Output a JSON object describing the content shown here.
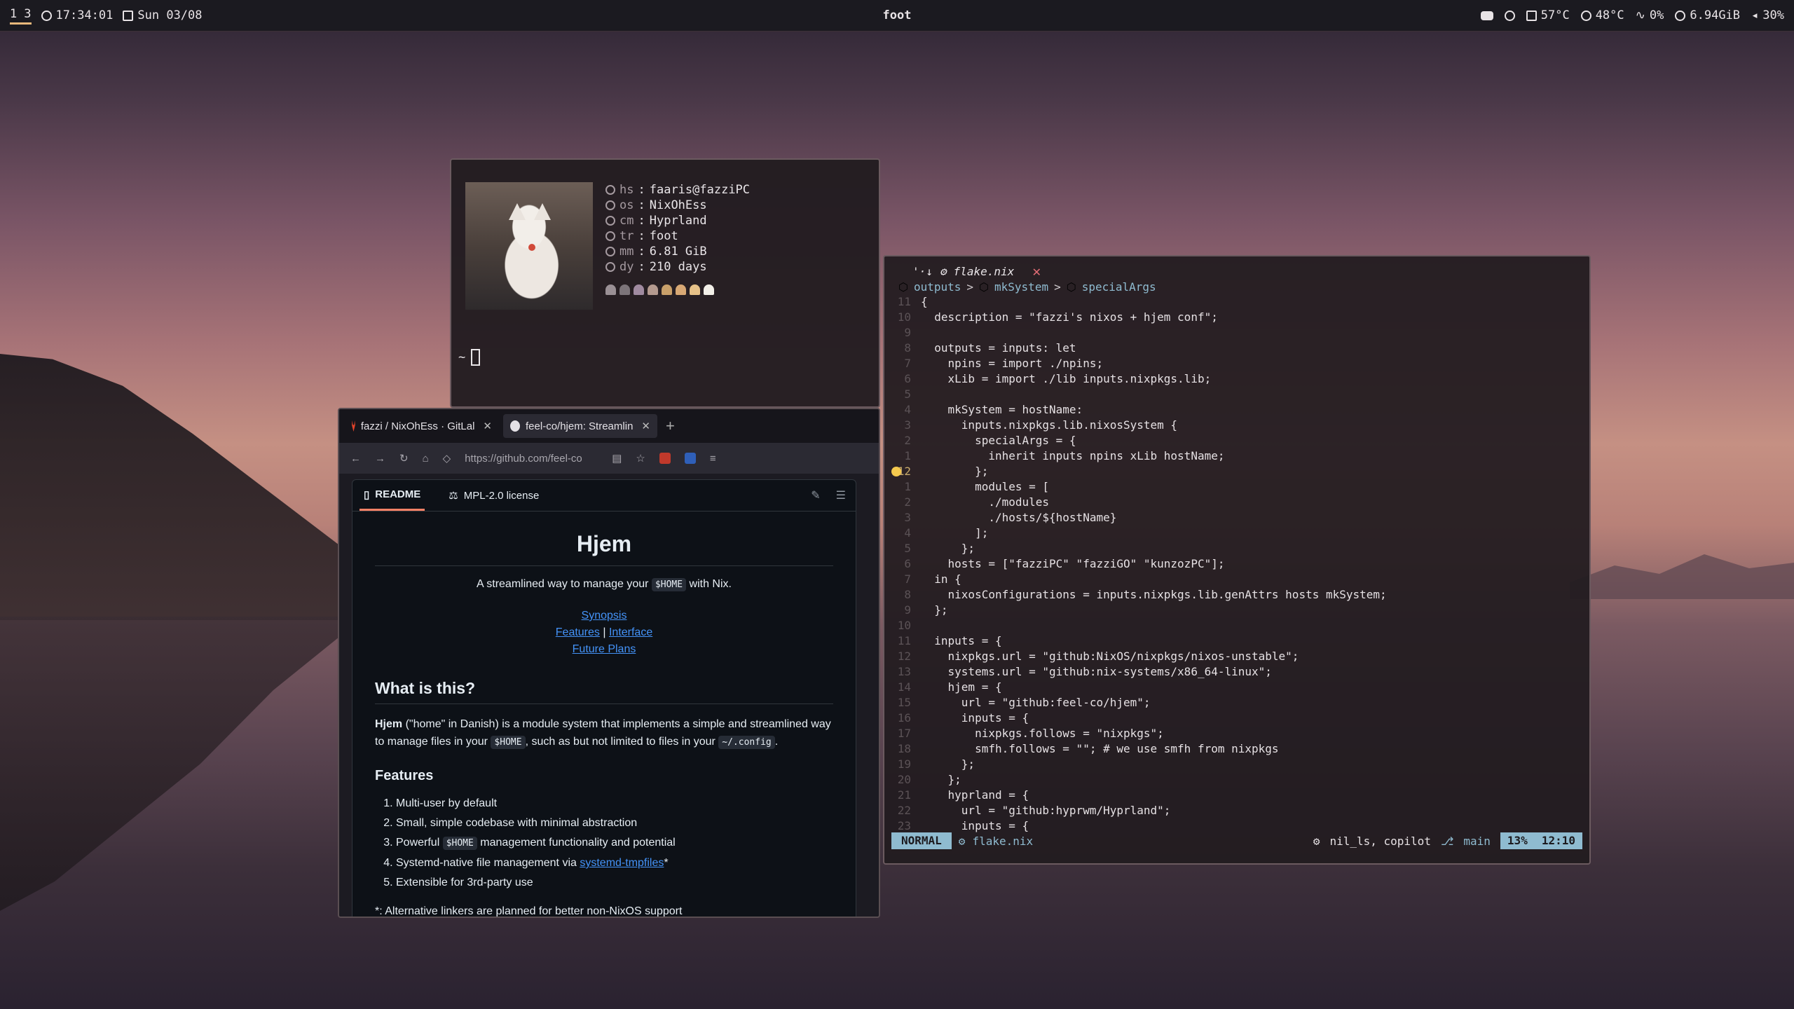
{
  "topbar": {
    "workspaces": [
      "1",
      "3"
    ],
    "time": "17:34:01",
    "date": "Sun 03/08",
    "window_title": "foot",
    "cpu_temp": "57°C",
    "gpu_temp": "48°C",
    "cpu_usage": "0%",
    "memory": "6.94GiB",
    "volume": "30%"
  },
  "fetch": {
    "rows": [
      {
        "key": "hs",
        "value": "faaris@fazziPC"
      },
      {
        "key": "os",
        "value": "NixOhEss"
      },
      {
        "key": "cm",
        "value": "Hyprland"
      },
      {
        "key": "tr",
        "value": "foot"
      },
      {
        "key": "mm",
        "value": "6.81 GiB"
      },
      {
        "key": "dy",
        "value": "210 days"
      }
    ],
    "ghost_colors": [
      "#9a9095",
      "#7c7479",
      "#a08aa0",
      "#b49a8f",
      "#c9a06a",
      "#d8a874",
      "#e6c188",
      "#f2efe8"
    ],
    "prompt": "~"
  },
  "browser": {
    "tabs": [
      {
        "label": "fazzi / NixOhEss · GitLal"
      },
      {
        "label": "feel-co/hjem: Streamlin"
      }
    ],
    "url": "https://github.com/feel-co",
    "readme_tab": "README",
    "license_tab": "MPL-2.0 license",
    "title": "Hjem",
    "tagline_pre": "A streamlined way to manage your",
    "tagline_code": "$HOME",
    "tagline_post": "with Nix.",
    "links": {
      "synopsis": "Synopsis",
      "features": "Features",
      "sep": "|",
      "interface": "Interface",
      "future": "Future Plans"
    },
    "h_what": "What is this?",
    "p1_bold": "Hjem",
    "p1_a": "(\"home\" in Danish) is a module system that implements a simple and streamlined way to manage files in your",
    "p1_code": "$HOME",
    "p1_b": ", such as but not limited to files in your",
    "p1_code2": "~/.config",
    "p1_c": ".",
    "h_features": "Features",
    "features": {
      "f1": "Multi-user by default",
      "f2": "Small, simple codebase with minimal abstraction",
      "f3_a": "Powerful",
      "f3_code": "$HOME",
      "f3_b": "management functionality and potential",
      "f4_a": "Systemd-native file management via",
      "f4_link": "systemd-tmpfiles",
      "f4_b": "*",
      "f5": "Extensible for 3rd-party use"
    },
    "footnote": "*: Alternative linkers are planned for better non-NixOS support"
  },
  "editor": {
    "tab_marker": "'·↓",
    "filename": "flake.nix",
    "breadcrumbs": [
      "outputs",
      "mkSystem",
      "specialArgs"
    ],
    "lines": [
      {
        "n": "11",
        "t": "{"
      },
      {
        "n": "10",
        "t": "  description = \"fazzi's nixos + hjem conf\";"
      },
      {
        "n": "9",
        "t": ""
      },
      {
        "n": "8",
        "t": "  outputs = inputs: let"
      },
      {
        "n": "7",
        "t": "    npins = import ./npins;"
      },
      {
        "n": "6",
        "t": "    xLib = import ./lib inputs.nixpkgs.lib;"
      },
      {
        "n": "5",
        "t": ""
      },
      {
        "n": "4",
        "t": "    mkSystem = hostName:"
      },
      {
        "n": "3",
        "t": "      inputs.nixpkgs.lib.nixosSystem {"
      },
      {
        "n": "2",
        "t": "        specialArgs = {"
      },
      {
        "n": "1",
        "t": "          inherit inputs npins xLib hostName;"
      },
      {
        "n": "12",
        "t": "        };"
      },
      {
        "n": "1",
        "t": "        modules = ["
      },
      {
        "n": "2",
        "t": "          ./modules"
      },
      {
        "n": "3",
        "t": "          ./hosts/${hostName}"
      },
      {
        "n": "4",
        "t": "        ];"
      },
      {
        "n": "5",
        "t": "      };"
      },
      {
        "n": "6",
        "t": "    hosts = [\"fazziPC\" \"fazziGO\" \"kunzozPC\"];"
      },
      {
        "n": "7",
        "t": "  in {"
      },
      {
        "n": "8",
        "t": "    nixosConfigurations = inputs.nixpkgs.lib.genAttrs hosts mkSystem;"
      },
      {
        "n": "9",
        "t": "  };"
      },
      {
        "n": "10",
        "t": ""
      },
      {
        "n": "11",
        "t": "  inputs = {"
      },
      {
        "n": "12",
        "t": "    nixpkgs.url = \"github:NixOS/nixpkgs/nixos-unstable\";"
      },
      {
        "n": "13",
        "t": "    systems.url = \"github:nix-systems/x86_64-linux\";"
      },
      {
        "n": "14",
        "t": "    hjem = {"
      },
      {
        "n": "15",
        "t": "      url = \"github:feel-co/hjem\";"
      },
      {
        "n": "16",
        "t": "      inputs = {"
      },
      {
        "n": "17",
        "t": "        nixpkgs.follows = \"nixpkgs\";"
      },
      {
        "n": "18",
        "t": "        smfh.follows = \"\"; # we use smfh from nixpkgs"
      },
      {
        "n": "19",
        "t": "      };"
      },
      {
        "n": "20",
        "t": "    };"
      },
      {
        "n": "21",
        "t": "    hyprland = {"
      },
      {
        "n": "22",
        "t": "      url = \"github:hyprwm/Hyprland\";"
      },
      {
        "n": "23",
        "t": "      inputs = {"
      }
    ],
    "mode": "NORMAL",
    "status_file": "flake.nix",
    "lsp": "nil_ls, copilot",
    "branch": "main",
    "percent": "13%",
    "position": "12:10"
  }
}
